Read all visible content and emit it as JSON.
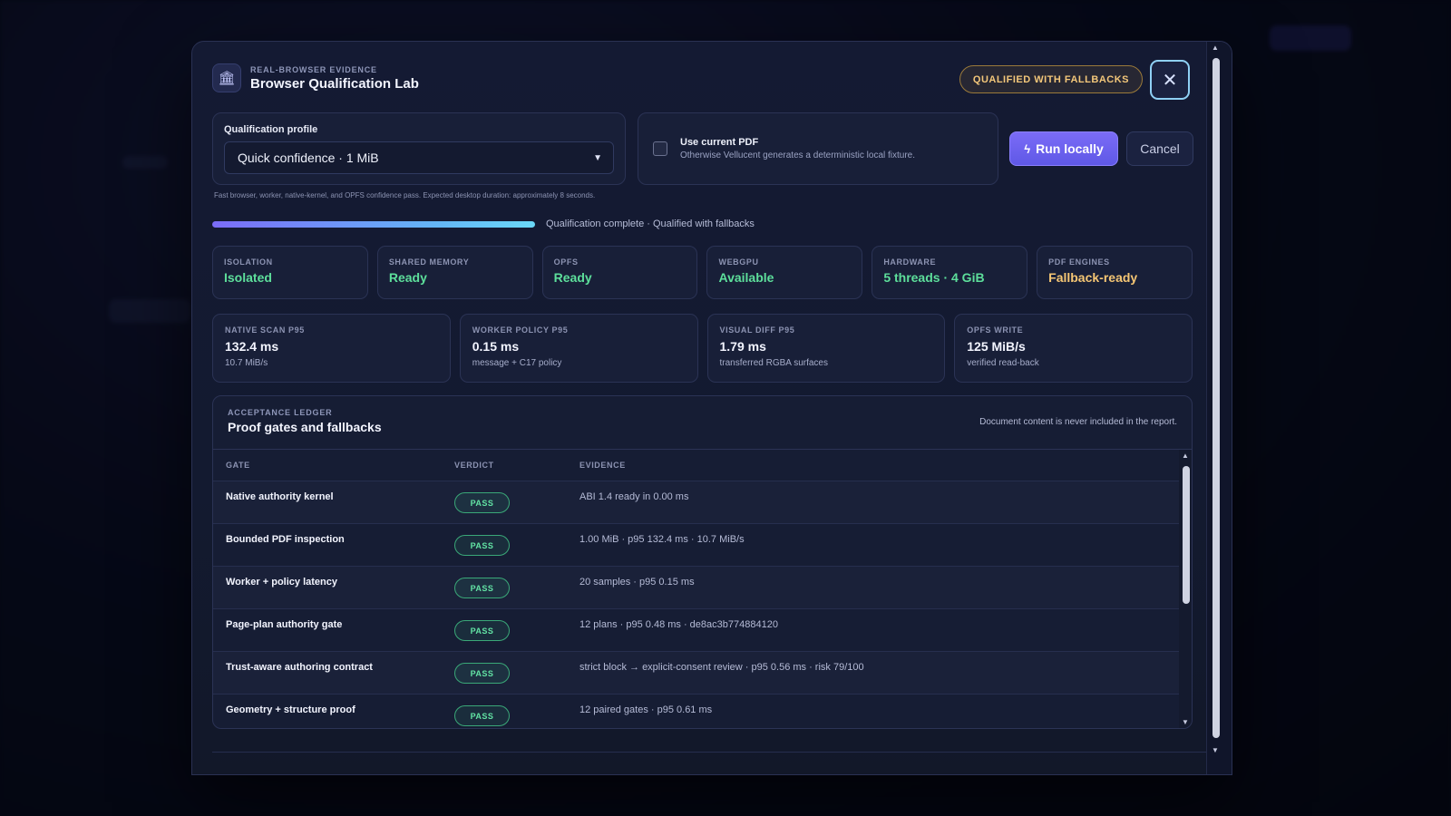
{
  "header": {
    "eyebrow": "REAL-BROWSER EVIDENCE",
    "title": "Browser Qualification Lab",
    "status": "QUALIFIED WITH FALLBACKS",
    "close_icon": "close-icon",
    "lab_icon": "bank-icon"
  },
  "profile": {
    "label": "Qualification profile",
    "selected": "Quick confidence · 1 MiB",
    "hint": "Fast browser, worker, native-kernel, and OPFS confidence pass. Expected desktop duration: approximately 8 seconds."
  },
  "pdf_option": {
    "title": "Use current PDF",
    "subtitle": "Otherwise Vellucent generates a deterministic local fixture.",
    "checked": false
  },
  "actions": {
    "run": "Run locally",
    "cancel": "Cancel"
  },
  "progress": {
    "fraction": 1.0,
    "text": "Qualification complete · Qualified with fallbacks"
  },
  "status_cards": [
    {
      "key": "ISOLATION",
      "value": "Isolated",
      "tone": "green"
    },
    {
      "key": "SHARED MEMORY",
      "value": "Ready",
      "tone": "green"
    },
    {
      "key": "OPFS",
      "value": "Ready",
      "tone": "green"
    },
    {
      "key": "WEBGPU",
      "value": "Available",
      "tone": "green"
    },
    {
      "key": "HARDWARE",
      "value": "5 threads · 4 GiB",
      "tone": "green"
    },
    {
      "key": "PDF ENGINES",
      "value": "Fallback-ready",
      "tone": "amber"
    }
  ],
  "metrics": [
    {
      "key": "NATIVE SCAN P95",
      "value": "132.4 ms",
      "sub": "10.7 MiB/s"
    },
    {
      "key": "WORKER POLICY P95",
      "value": "0.15 ms",
      "sub": "message + C17 policy"
    },
    {
      "key": "VISUAL DIFF P95",
      "value": "1.79 ms",
      "sub": "transferred RGBA surfaces"
    },
    {
      "key": "OPFS WRITE",
      "value": "125 MiB/s",
      "sub": "verified read-back"
    }
  ],
  "ledger": {
    "eyebrow": "ACCEPTANCE LEDGER",
    "title": "Proof gates and fallbacks",
    "note": "Document content is never included in the report.",
    "columns": [
      "GATE",
      "VERDICT",
      "EVIDENCE"
    ],
    "rows": [
      {
        "gate": "Native authority kernel",
        "verdict": "PASS",
        "evidence": "ABI 1.4 ready in 0.00 ms"
      },
      {
        "gate": "Bounded PDF inspection",
        "verdict": "PASS",
        "evidence": "1.00 MiB · p95 132.4 ms · 10.7 MiB/s"
      },
      {
        "gate": "Worker + policy latency",
        "verdict": "PASS",
        "evidence": "20 samples · p95 0.15 ms"
      },
      {
        "gate": "Page-plan authority gate",
        "verdict": "PASS",
        "evidence": "12 plans · p95 0.48 ms · de8ac3b774884120"
      },
      {
        "gate": "Trust-aware authoring contract",
        "verdict": "PASS",
        "evidence": "strict block → explicit-consent review · p95 0.56 ms · risk 79/100"
      },
      {
        "gate": "Geometry + structure proof",
        "verdict": "PASS",
        "evidence": "12 paired gates · p95 0.61 ms"
      }
    ]
  },
  "colors": {
    "accent": "#6c62f0",
    "pass": "#62e3a4",
    "warning": "#f3c77a"
  }
}
